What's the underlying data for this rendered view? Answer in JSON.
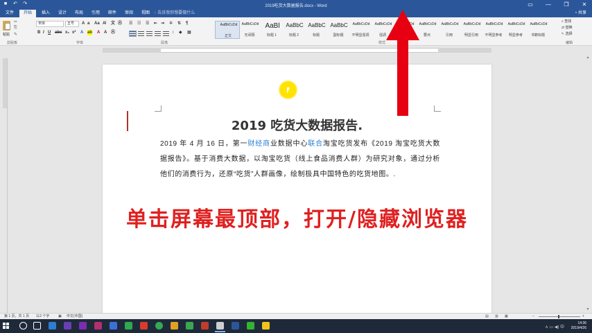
{
  "window": {
    "title": "2019吃货大数据报告.docx - Word",
    "controls": [
      "—",
      "❐",
      "✕"
    ]
  },
  "ribbon": {
    "tabs": [
      "文件",
      "开始",
      "插入",
      "设计",
      "布局",
      "引用",
      "邮件",
      "审阅",
      "视图"
    ],
    "active_tab": "开始",
    "search_placeholder": "告诉我你想要做什么",
    "share": "共享",
    "clipboard": {
      "paste_label": "粘贴",
      "group": "剪贴板"
    },
    "font": {
      "family": "宋体",
      "size": "五号",
      "group": "字体"
    },
    "paragraph_group": "段落",
    "styles_group": "样式",
    "styles": [
      {
        "sample": "AaBbCcDd",
        "name": "正文"
      },
      {
        "sample": "AaBbCcDd",
        "name": "无间隔"
      },
      {
        "sample": "AaBl",
        "name": "标题 1"
      },
      {
        "sample": "AaBbC",
        "name": "标题 2"
      },
      {
        "sample": "AaBbC",
        "name": "标题"
      },
      {
        "sample": "AaBbC",
        "name": "副标题"
      },
      {
        "sample": "AaBbCcDd",
        "name": "不明显强调"
      },
      {
        "sample": "AaBbCcDd",
        "name": "强调"
      },
      {
        "sample": "AaBbCcDd",
        "name": "明显强调"
      },
      {
        "sample": "AaBbCcDd",
        "name": "要点"
      },
      {
        "sample": "AaBbCcDd",
        "name": "引用"
      },
      {
        "sample": "AaBbCcDd",
        "name": "明显引用"
      },
      {
        "sample": "AaBbCcDd",
        "name": "不明显参考"
      },
      {
        "sample": "AaBbCcDd",
        "name": "明显参考"
      },
      {
        "sample": "AaBbCcDd",
        "name": "书籍标题"
      }
    ],
    "editing": [
      "查找",
      "替换",
      "选择"
    ],
    "editing_group": "编辑"
  },
  "document": {
    "title": "2019 吃货大数据报告.",
    "body_before_link1": "2019 年 4 月 16 日，第一",
    "link1": "财经商",
    "body_mid1": "业数据中心",
    "link2": "联合",
    "body_rest": "淘宝吃货发布《2019 淘宝吃货大数据报告》。基于消费大数据，以淘宝吃货（线上食品消费人群）为研究对象，通过分析他们的消费行为，还原“吃货”人群画像，绘制极具中国特色的吃货地图。."
  },
  "overlay": {
    "instruction": "单击屏幕最顶部，打开/隐藏浏览器"
  },
  "statusbar": {
    "page": "第 1 页，共 1 页",
    "words": "112 个字",
    "language": "中文(中国)",
    "zoom": "100%"
  },
  "taskbar": {
    "time": "14:36",
    "date": "2019/4/26"
  },
  "colors": {
    "word_blue": "#2b579a",
    "arrow_red": "#e60012",
    "overlay_red": "#e02020",
    "link_blue": "#2a7fd6",
    "cursor_yellow": "#ffe800"
  }
}
